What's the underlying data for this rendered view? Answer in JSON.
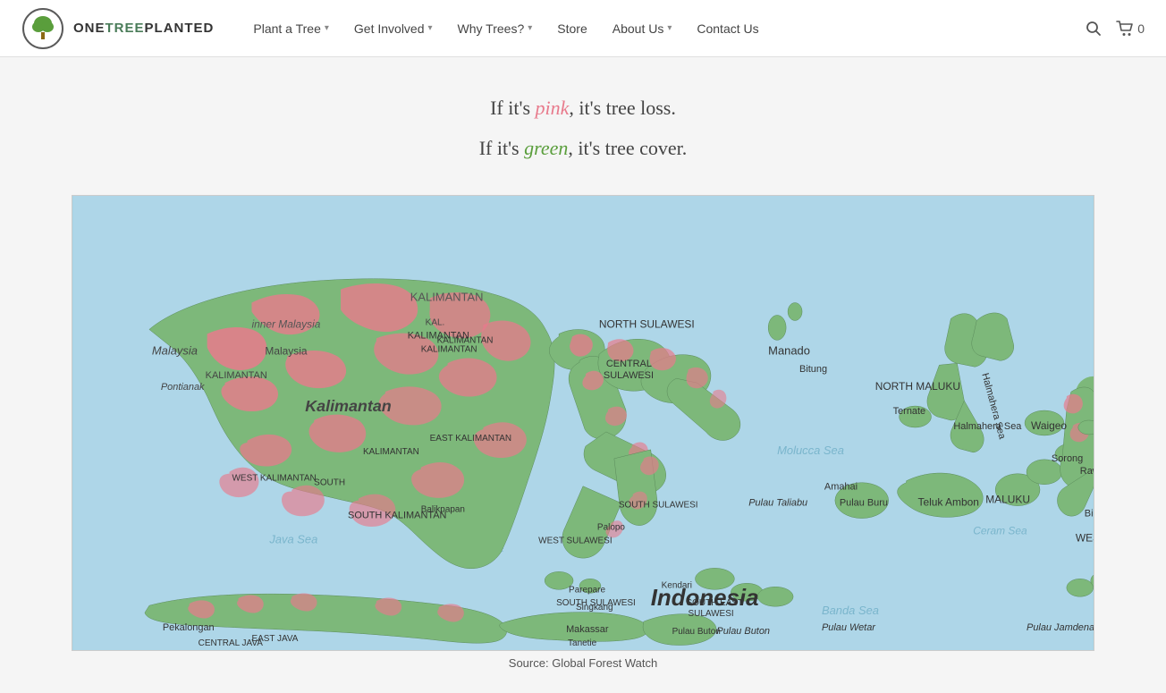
{
  "header": {
    "logo_text_one": "ONE",
    "logo_text_tree": "TREE",
    "logo_text_planted": "PLANTED",
    "nav": [
      {
        "label": "Plant a Tree",
        "has_dropdown": true
      },
      {
        "label": "Get Involved",
        "has_dropdown": true
      },
      {
        "label": "Why Trees?",
        "has_dropdown": true
      },
      {
        "label": "Store",
        "has_dropdown": false
      },
      {
        "label": "About Us",
        "has_dropdown": true
      },
      {
        "label": "Contact Us",
        "has_dropdown": false
      }
    ],
    "cart_count": "0"
  },
  "main": {
    "tagline_pink_prefix": "If it's ",
    "tagline_pink_word": "pink",
    "tagline_pink_suffix": ", it's tree loss.",
    "tagline_green_prefix": "If it's ",
    "tagline_green_word": "green",
    "tagline_green_suffix": ", it's tree cover.",
    "map_source": "Source: Global Forest Watch"
  },
  "icons": {
    "search": "🔍",
    "cart": "🛒",
    "tree_logo": "🌳"
  }
}
